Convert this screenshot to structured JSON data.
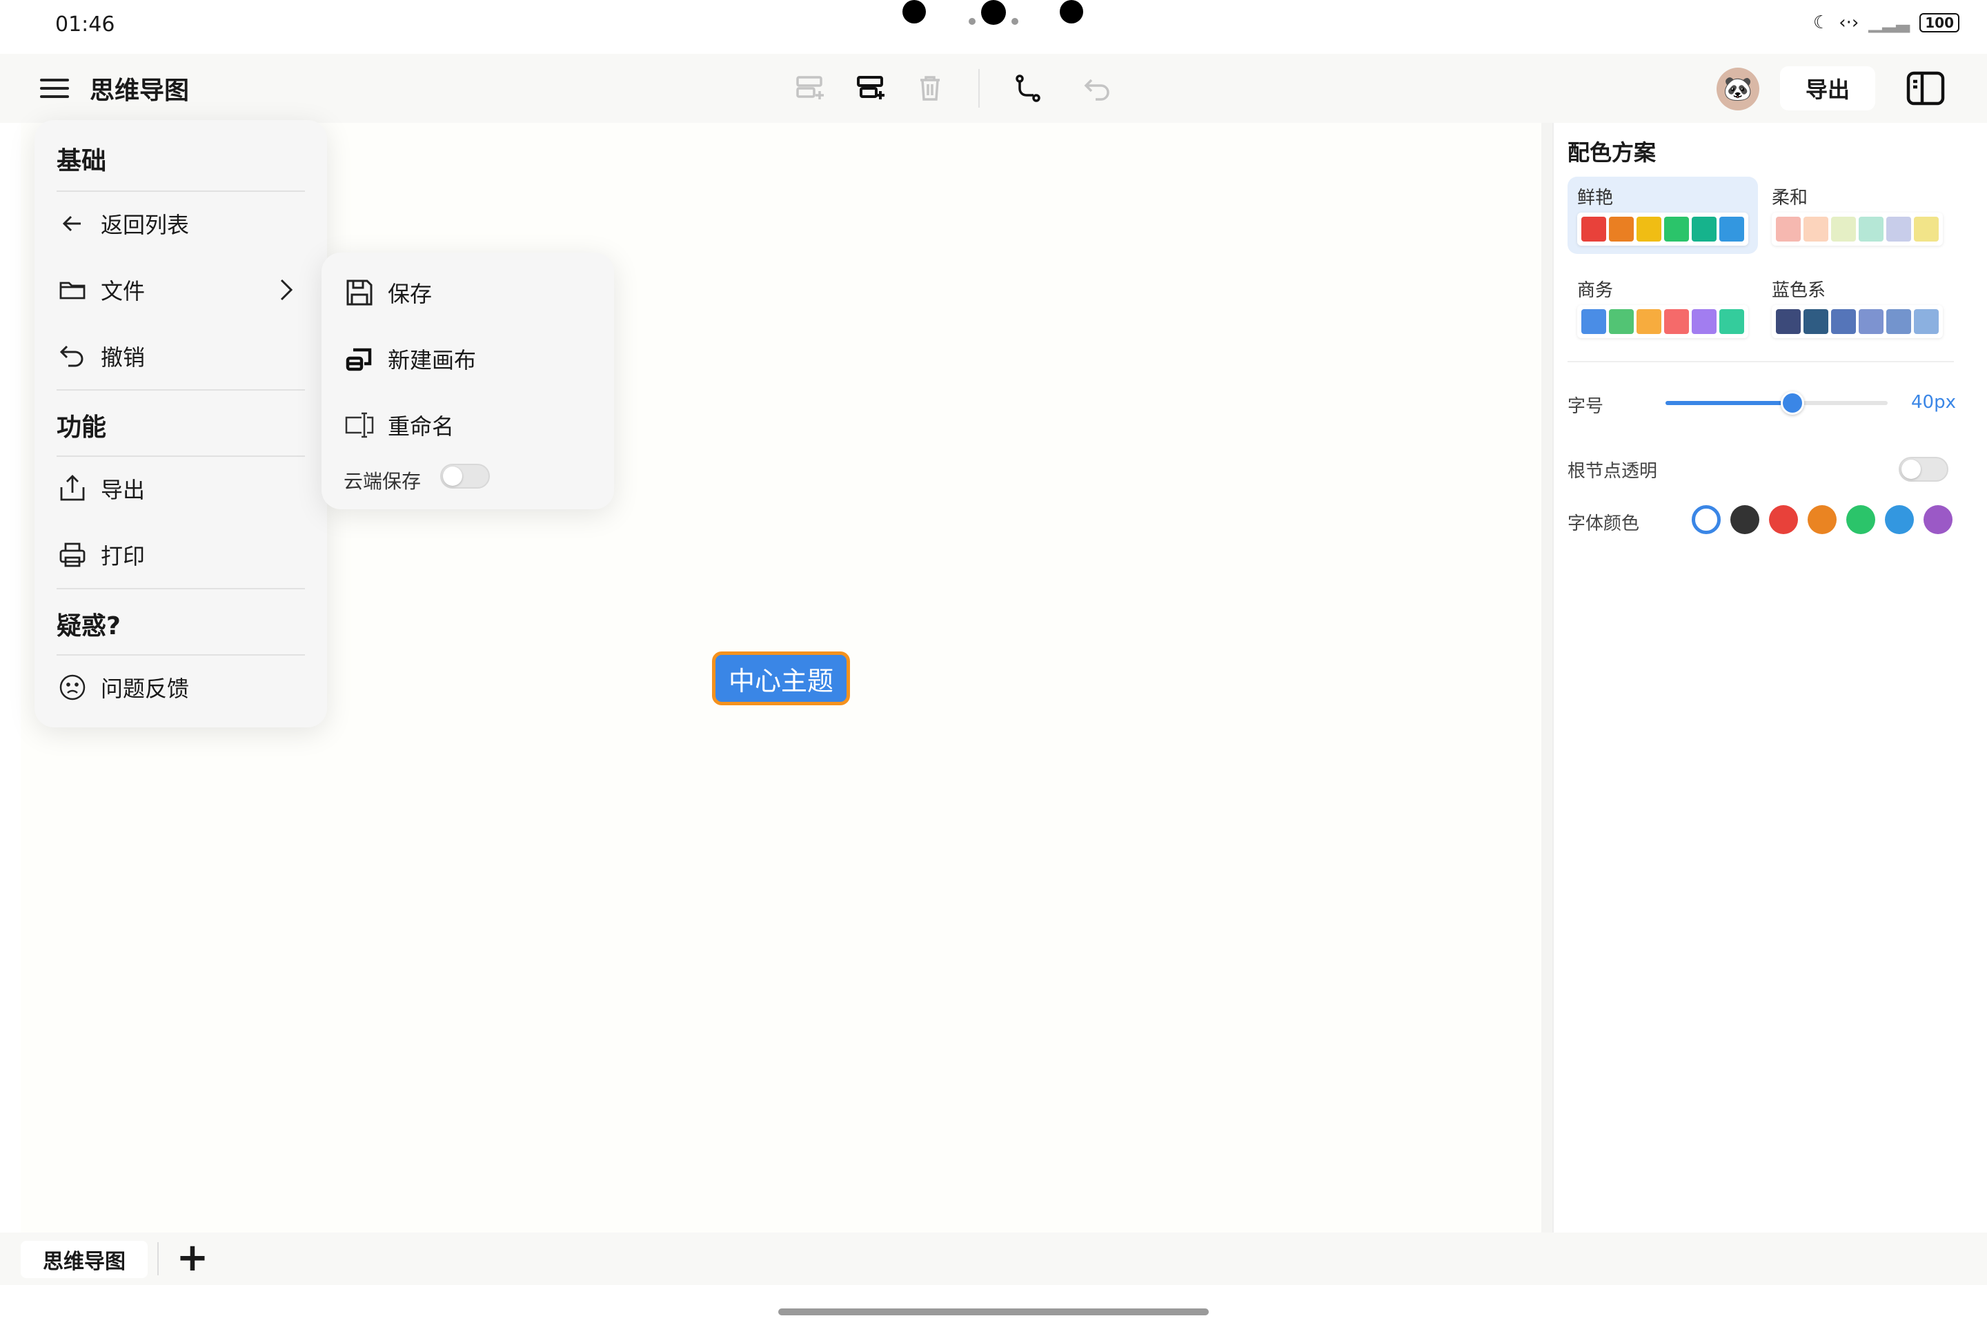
{
  "status": {
    "time": "01:46",
    "battery": "100"
  },
  "app": {
    "title": "思维导图",
    "export_label": "导出"
  },
  "canvas": {
    "root_node": "中心主题"
  },
  "tabs": {
    "active": "思维导图",
    "add": "+"
  },
  "side_menu": {
    "section_basic": "基础",
    "back": "返回列表",
    "file": "文件",
    "undo": "撤销",
    "section_function": "功能",
    "export": "导出",
    "print": "打印",
    "section_question": "疑惑?",
    "feedback": "问题反馈"
  },
  "file_submenu": {
    "save": "保存",
    "new_canvas": "新建画布",
    "rename": "重命名",
    "cloud_save": "云端保存",
    "cloud_save_on": false
  },
  "right_panel": {
    "color_scheme_title": "配色方案",
    "schemes": [
      {
        "name": "鲜艳",
        "selected": true,
        "colors": [
          "#e8413a",
          "#ea7f22",
          "#f0bd14",
          "#2bc46a",
          "#16b38c",
          "#3397e0"
        ]
      },
      {
        "name": "柔和",
        "selected": false,
        "colors": [
          "#f6b8b0",
          "#fcd4bc",
          "#e5efc5",
          "#b5e7d6",
          "#c8cdea",
          "#f2e489"
        ]
      },
      {
        "name": "商务",
        "selected": false,
        "colors": [
          "#4a8de6",
          "#52c474",
          "#f7ac3e",
          "#f56a6a",
          "#a27df0",
          "#34cc9c"
        ]
      },
      {
        "name": "蓝色系",
        "selected": false,
        "colors": [
          "#3c4a7a",
          "#2f5c83",
          "#5575b9",
          "#7d93d0",
          "#7394cd",
          "#8bb0e0"
        ]
      }
    ],
    "font_size_label": "字号",
    "font_size_value": "40px",
    "font_size_fraction": 0.57,
    "root_transparent_label": "根节点透明",
    "root_transparent_on": false,
    "font_color_label": "字体颜色",
    "font_colors": [
      "#ffffff",
      "#333333",
      "#e8413a",
      "#ea8422",
      "#2bc46a",
      "#3397e0",
      "#9b59c6"
    ],
    "font_color_selected": 0
  },
  "icons": {
    "menu": "hamburger-icon",
    "add_child": "add-child-node-icon",
    "add_sibling": "add-sibling-node-icon",
    "delete": "trash-icon",
    "connect": "connector-icon",
    "undo": "undo-icon",
    "avatar": "panda-avatar-icon",
    "panel_toggle": "sidebar-toggle-icon"
  }
}
